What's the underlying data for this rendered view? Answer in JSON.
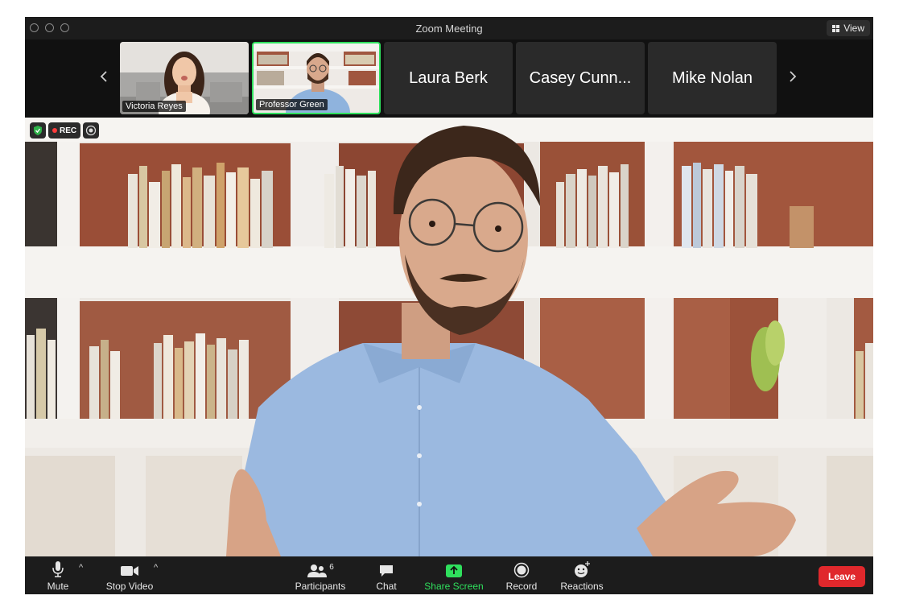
{
  "window": {
    "title": "Zoom Meeting",
    "view_label": "View"
  },
  "gallery": {
    "tiles": [
      {
        "name": "Victoria Reyes",
        "type": "video"
      },
      {
        "name": "Professor Green",
        "type": "video",
        "active": true
      },
      {
        "name": "Laura Berk",
        "type": "name"
      },
      {
        "name": "Casey Cunn...",
        "type": "name"
      },
      {
        "name": "Mike Nolan",
        "type": "name"
      }
    ]
  },
  "status": {
    "rec_label": "REC",
    "colors": {
      "shield": "#2fb34a",
      "rec_dot": "#ff3b3b"
    }
  },
  "toolbar": {
    "mute": "Mute",
    "stop_video": "Stop Video",
    "participants": "Participants",
    "participants_count": "6",
    "chat": "Chat",
    "share_screen": "Share Screen",
    "record": "Record",
    "reactions": "Reactions",
    "leave": "Leave"
  },
  "colors": {
    "accent_green": "#2fe05d",
    "leave_red": "#e0282c",
    "toolbar_bg": "#1c1c1c"
  }
}
